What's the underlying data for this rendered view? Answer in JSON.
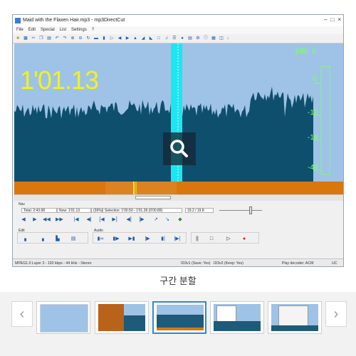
{
  "window": {
    "title": "Maid with the Flaxen Hair.mp3 - mp3DirectCut"
  },
  "menu": [
    "File",
    "Edit",
    "Special",
    "List",
    "Settings",
    "?"
  ],
  "display": {
    "time": "1'01.13",
    "db_unit": "[dB]",
    "db_scale": [
      "0",
      "-6",
      "-12",
      "-18",
      "-48"
    ]
  },
  "nav": {
    "label": "Nav",
    "total": "Total: 2:43.68",
    "now": "Now: 1'01.13",
    "percent": "(36%)",
    "selection": "Selection: 1'00.50 - 1'01.39 (0'00.89)",
    "ratio": "19.2 / 19.8"
  },
  "edit": {
    "label": "Edit"
  },
  "audio": {
    "label": "Audio"
  },
  "status": {
    "layer": "MPEG1.0 Layer 3 - 192 kbps - 44 kHz - Stereo",
    "id3v1": "ID3v1 (Save: Yes)",
    "id3v2": "ID3v2 (Keep: Yes)",
    "decoder": "Play decoder: ACM",
    "uc": "UC"
  },
  "caption": "구간 분할",
  "colors": {
    "accent": "#2a8bd6",
    "wave_bg": "#9ec3e6",
    "wave": "#0f4f6e",
    "time": "#f2f21e",
    "selection": "#1ee6f0",
    "orange": "#d9760d",
    "db": "#7cff6a"
  },
  "icons": {
    "zoom": "magnifier-icon",
    "prev": "chevron-left-icon",
    "next": "chevron-right-icon"
  }
}
